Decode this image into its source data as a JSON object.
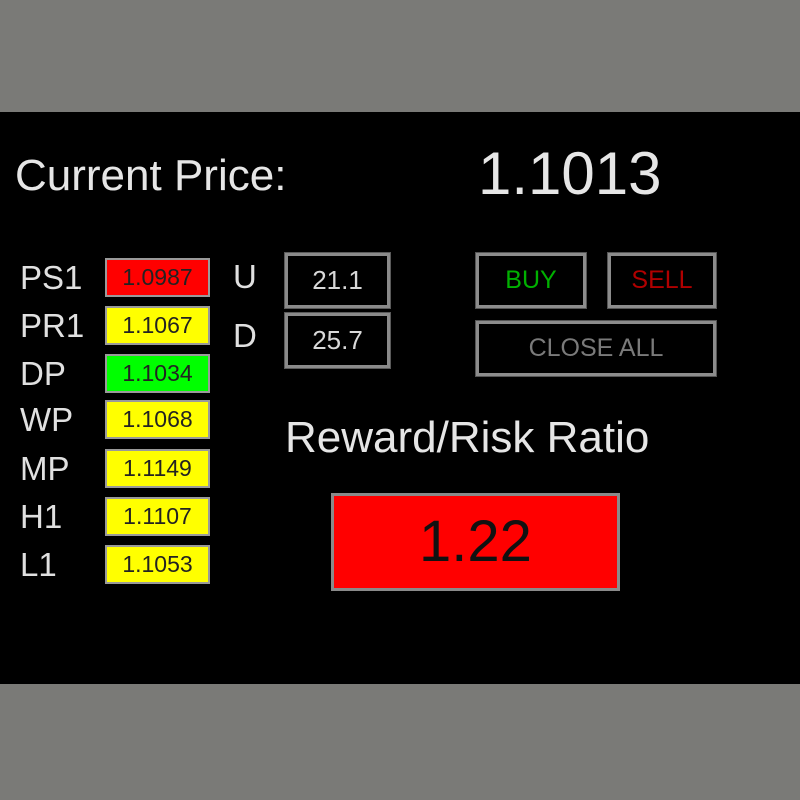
{
  "current_price": {
    "label": "Current Price:",
    "value": "1.1013"
  },
  "levels": [
    {
      "label": "PS1",
      "value": "1.0987",
      "color": "#ff0000"
    },
    {
      "label": "PR1",
      "value": "1.1067",
      "color": "#ffff00"
    },
    {
      "label": "DP",
      "value": "1.1034",
      "color": "#00ff00"
    },
    {
      "label": "WP",
      "value": "1.1068",
      "color": "#ffff00"
    },
    {
      "label": "MP",
      "value": "1.1149",
      "color": "#ffff00"
    },
    {
      "label": "H1",
      "value": "1.1107",
      "color": "#ffff00"
    },
    {
      "label": "L1",
      "value": "1.1053",
      "color": "#ffff00"
    }
  ],
  "distances": {
    "up": {
      "label": "U",
      "value": "21.1"
    },
    "down": {
      "label": "D",
      "value": "25.7"
    }
  },
  "buttons": {
    "buy": "BUY",
    "sell": "SELL",
    "close_all": "CLOSE ALL"
  },
  "reward_risk": {
    "label": "Reward/Risk Ratio",
    "value": "1.22",
    "color": "#ff0000"
  }
}
